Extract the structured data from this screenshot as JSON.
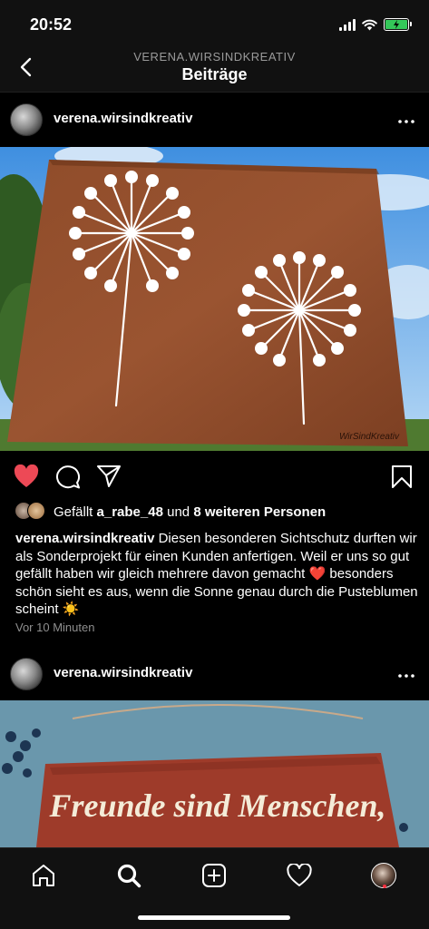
{
  "status_bar": {
    "time": "20:52"
  },
  "header": {
    "account": "VERENA.WIRSINDKREATIV",
    "title": "Beiträge"
  },
  "posts": [
    {
      "username": "verena.wirsindkreativ",
      "image_watermark": "WirSindKreativ",
      "liked": true,
      "likes_prefix": "Gefällt",
      "likes_user": "a_rabe_48",
      "likes_mid": "und",
      "likes_others": "8 weiteren Personen",
      "caption_user": "verena.wirsindkreativ",
      "caption_part1": "Diesen besonderen Sichtschutz durften wir als Sonderprojekt für einen Kunden anfertigen. Weil er uns so gut gefällt haben wir gleich mehrere davon gemacht",
      "caption_emoji1": "❤️",
      "caption_part2": "besonders schön sieht es aus, wenn die Sonne genau durch die Pusteblumen scheint",
      "caption_emoji2": "☀️",
      "time_ago": "Vor 10 Minuten"
    },
    {
      "username": "verena.wirsindkreativ",
      "image_text": "Freunde sind Menschen,"
    }
  ],
  "colors": {
    "like_red": "#ed4956",
    "corten": "#8a4a2a",
    "battery": "#34c759"
  },
  "icons": [
    "back-chevron-icon",
    "heart-icon",
    "comment-icon",
    "share-icon",
    "bookmark-icon",
    "more-icon",
    "home-icon",
    "search-icon",
    "add-icon",
    "activity-icon",
    "profile-icon"
  ]
}
